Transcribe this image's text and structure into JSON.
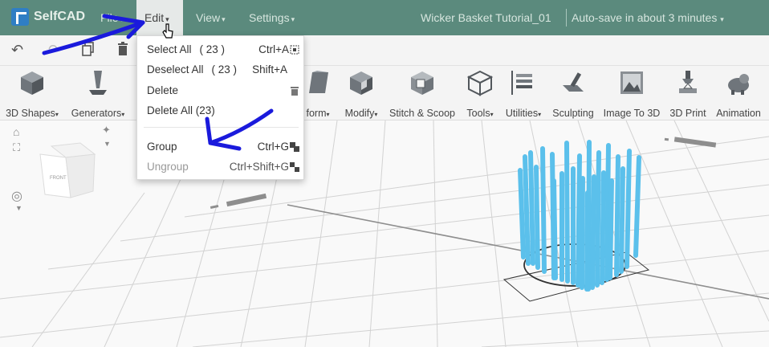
{
  "app": {
    "name": "SelfCAD"
  },
  "menu": {
    "file": "File",
    "edit": "Edit",
    "view": "View",
    "settings": "Settings"
  },
  "document": {
    "title": "Wicker Basket Tutorial_01",
    "autosave": "Auto-save in about 3 minutes"
  },
  "edit_menu": {
    "items": [
      {
        "label": "Select All",
        "count": "( 23 )",
        "shortcut": "Ctrl+A"
      },
      {
        "label": "Deselect All",
        "count": "( 23 )",
        "shortcut": "Shift+A"
      },
      {
        "label": "Delete",
        "count": "",
        "shortcut": ""
      },
      {
        "label": "Delete All (23)",
        "count": "",
        "shortcut": ""
      },
      {
        "label": "Group",
        "count": "",
        "shortcut": "Ctrl+G"
      },
      {
        "label": "Ungroup",
        "count": "",
        "shortcut": "Ctrl+Shift+G"
      }
    ]
  },
  "toolbar": {
    "shapes": "3D Shapes",
    "generators": "Generators",
    "transform": "form",
    "modify": "Modify",
    "stitch": "Stitch & Scoop",
    "tools": "Tools",
    "utilities": "Utilities",
    "sculpting": "Sculpting",
    "image_to_3d": "Image To 3D",
    "print": "3D Print",
    "animation": "Animation"
  },
  "viewcube": {
    "face": "FRONT"
  },
  "colors": {
    "topbar": "#5b8a7d",
    "accent": "#2f7ec4",
    "object": "#5bc0eb",
    "annotation": "#1a1adc"
  },
  "icons": [
    "undo-icon",
    "redo-icon",
    "copy-icon",
    "trash-icon",
    "home-icon",
    "fit-icon",
    "target-icon",
    "light-icon",
    "pointer-cursor-icon"
  ]
}
